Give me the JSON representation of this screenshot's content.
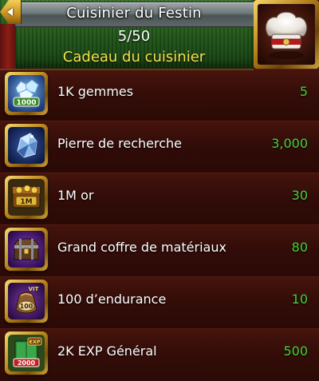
{
  "header": {
    "title": "Cuisinier du Festin",
    "progress": "5/50",
    "subtitle": "Cadeau du cuisinier",
    "back_icon": "back-arrow-icon",
    "portrait_icon": "chef-hat-icon",
    "subtitle_color": "#f6e34a"
  },
  "rewards": [
    {
      "icon": "gems-1000-icon",
      "name": "1K gemmes",
      "count": "5",
      "icon_label": "1000"
    },
    {
      "icon": "research-stone-icon",
      "name": "Pierre de recherche",
      "count": "3,000"
    },
    {
      "icon": "gold-1m-icon",
      "name": "1M or",
      "count": "30",
      "icon_label": "1M"
    },
    {
      "icon": "material-chest-icon",
      "name": "Grand coffre de matériaux",
      "count": "80"
    },
    {
      "icon": "endurance-bag-icon",
      "name": "100 d’endurance",
      "count": "10",
      "icon_label": "100",
      "icon_tag": "VIT"
    },
    {
      "icon": "general-exp-book-icon",
      "name": "2K EXP Général",
      "count": "500",
      "icon_label": "2000",
      "icon_tag": "EXP"
    }
  ],
  "colors": {
    "count_green": "#45d13a",
    "name_white": "#ffffff",
    "banner_green": "#245a1a",
    "row_dark_red": "#3a0f08",
    "gold_frame": "#c08a1e"
  }
}
